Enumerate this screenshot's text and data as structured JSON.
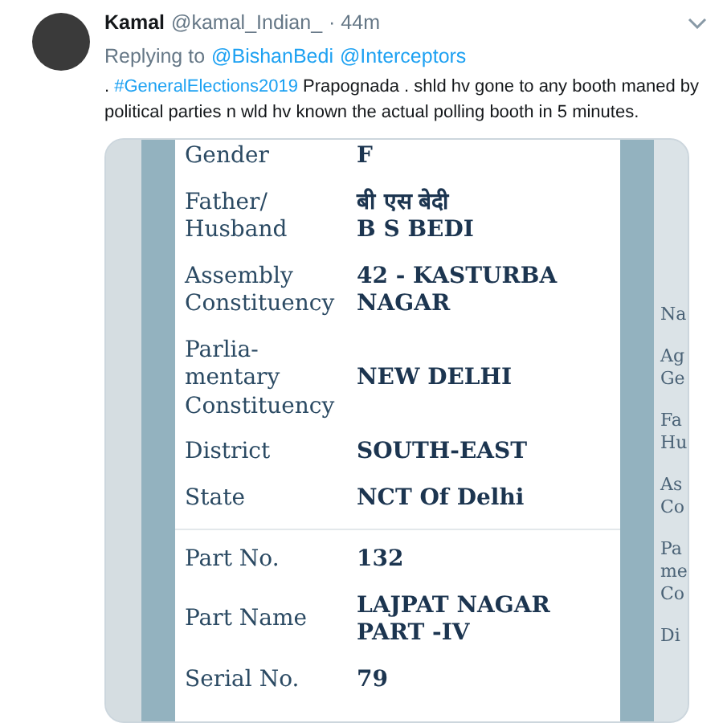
{
  "tweet": {
    "author_name": "Kamal",
    "handle": "@kamal_Indian_",
    "time": "· 44m",
    "replying_label": "Replying to",
    "reply_mentions": [
      "@BishanBedi",
      "@Interceptors"
    ],
    "text_parts": [
      {
        "kind": "plain",
        "text": ". "
      },
      {
        "kind": "hashtag",
        "text": "#GeneralElections2019"
      },
      {
        "kind": "plain",
        "text": " Prapognada . shld hv gone to any booth maned by political parties n wld hv known the actual polling booth in 5 minutes."
      }
    ]
  },
  "attached_image": {
    "sections": [
      [
        {
          "label": "Gender",
          "value": "F"
        },
        {
          "label": "Father/\nHusband",
          "value": "बी एस  बेदी\nB S  BEDI"
        },
        {
          "label": "Assembly\nConstituency",
          "value": "42 - KASTURBA\nNAGAR"
        },
        {
          "label": "Parlia-\nmentary\nConstituency",
          "value": "NEW DELHI"
        },
        {
          "label": "District",
          "value": "SOUTH-EAST"
        },
        {
          "label": "State",
          "value": "NCT Of Delhi"
        }
      ],
      [
        {
          "label": "Part No.",
          "value": "132"
        },
        {
          "label": "Part Name",
          "value": "LAJPAT NAGAR\nPART -IV"
        },
        {
          "label": "Serial No.",
          "value": "79"
        }
      ]
    ],
    "next_card_labels": [
      "Na",
      "Ag\nGe",
      "Fa\nHu",
      "As\nCo",
      "Pa\nme\nCo",
      "Di"
    ]
  }
}
